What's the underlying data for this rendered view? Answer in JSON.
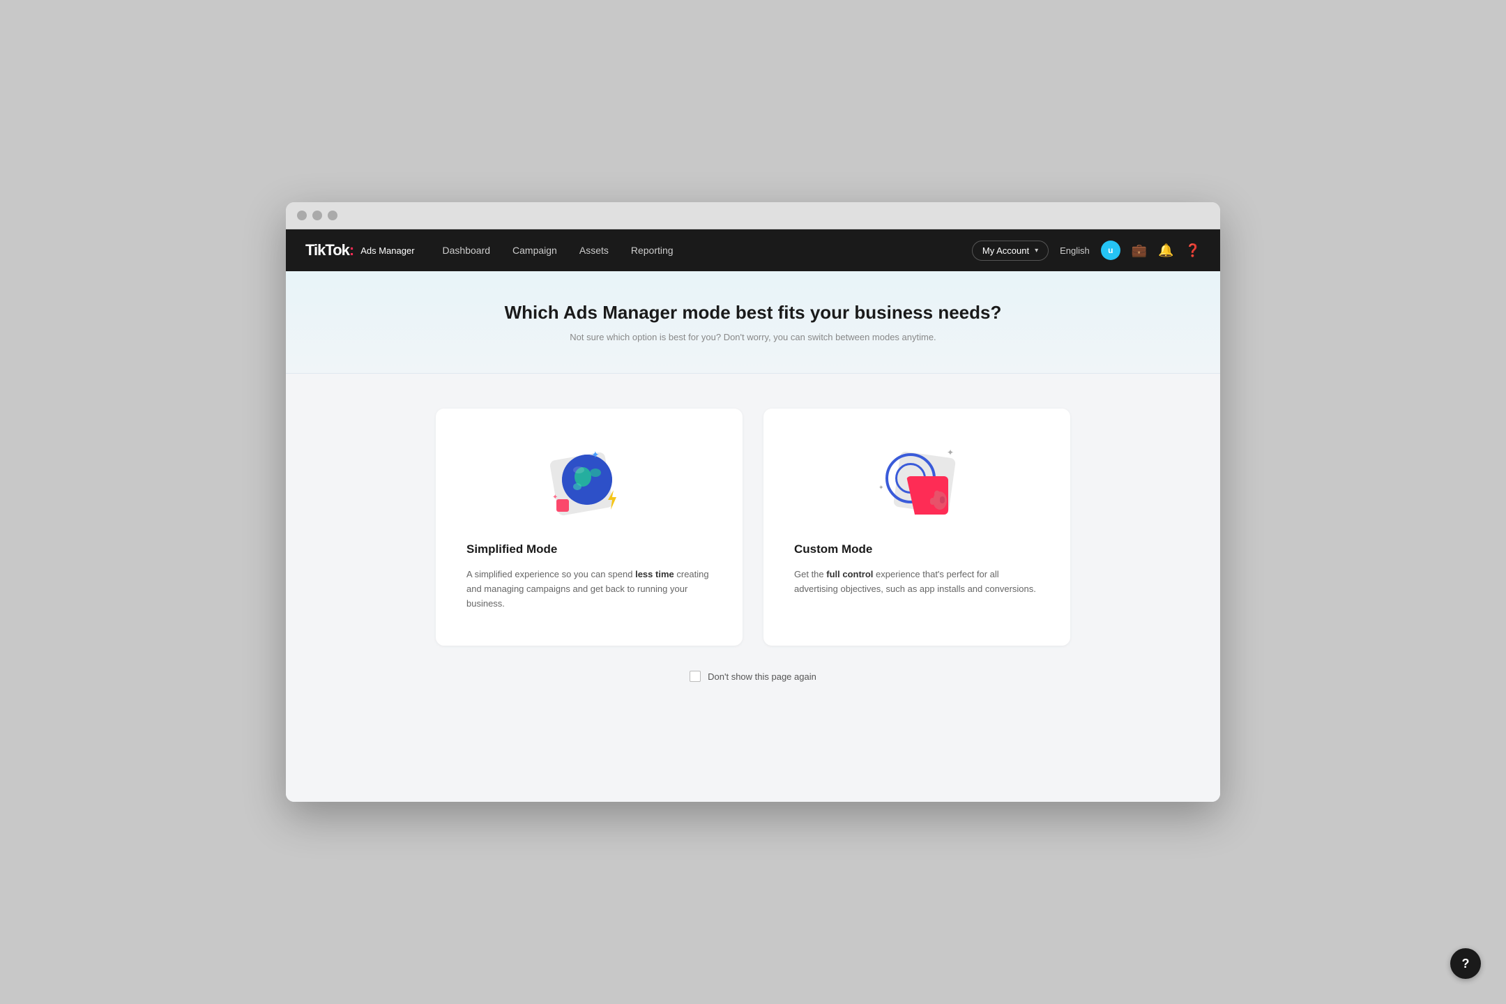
{
  "browser": {
    "dots": [
      "dot1",
      "dot2",
      "dot3"
    ]
  },
  "nav": {
    "logo_tiktok": "TikTok",
    "logo_colon": ":",
    "logo_ads": "Ads Manager",
    "links": [
      {
        "id": "dashboard",
        "label": "Dashboard"
      },
      {
        "id": "campaign",
        "label": "Campaign"
      },
      {
        "id": "assets",
        "label": "Assets"
      },
      {
        "id": "reporting",
        "label": "Reporting"
      }
    ],
    "account_label": "My Account",
    "lang": "English",
    "user_initial": "u"
  },
  "hero": {
    "title": "Which Ads Manager mode best fits your business needs?",
    "subtitle": "Not sure which option is best for you? Don't worry, you can switch between modes anytime."
  },
  "cards": [
    {
      "id": "simplified",
      "title": "Simplified Mode",
      "desc_before": "A simplified experience so you can spend ",
      "desc_bold": "less time",
      "desc_after": " creating and managing campaigns and get back to running your business."
    },
    {
      "id": "custom",
      "title": "Custom Mode",
      "desc_before": "Get the ",
      "desc_bold": "full control",
      "desc_after": " experience that's perfect for all advertising objectives, such as app installs and conversions."
    }
  ],
  "checkbox": {
    "label": "Don't show this page again"
  },
  "floating_help": {
    "icon": "?"
  }
}
